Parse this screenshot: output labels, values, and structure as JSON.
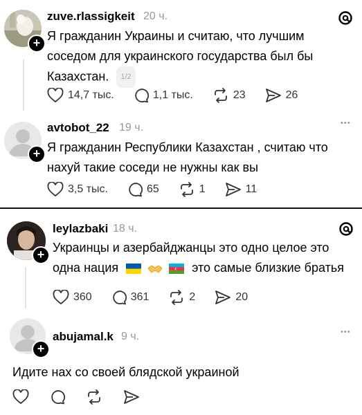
{
  "c1": {
    "username": "zuve.rlassigkeit",
    "time": "20 ч.",
    "text": "Я гражданин Украины и считаю, что лучшим соседом для украинского государства был бы Казахстан.",
    "pager": "1/2",
    "likes": "14,7 тыс.",
    "replies": "1,1 тыс.",
    "reposts": "23",
    "shares": "26"
  },
  "c2": {
    "username": "avtobot_22",
    "time": "19 ч.",
    "more": "•••",
    "line1": "Я  гражданин Республики Казахстан , считаю что",
    "line2": "нахуй такие соседи не нужны как вы",
    "likes": "3,5 тыс.",
    "replies": "65",
    "reposts": "1",
    "shares": "11"
  },
  "c3": {
    "username": "leylazbaki",
    "time": "18 ч.",
    "line1": "Украинцы и азербайджанцы это одно целое это",
    "line2a": "одна нация",
    "line2b": "это самые близкие братья",
    "likes": "360",
    "replies": "361",
    "reposts": "2",
    "shares": "20"
  },
  "c4": {
    "username": "abujamal.k",
    "time": "9 ч.",
    "more": "•••",
    "text": "Идите нах со своей блядской украиной"
  },
  "colors": {
    "ukraine_blue": "#0057b7",
    "ukraine_yellow": "#ffd700",
    "azerbaijan_blue": "#00b5e2",
    "azerbaijan_red": "#ef3340",
    "azerbaijan_green": "#509e2f",
    "muted": "#999999"
  }
}
